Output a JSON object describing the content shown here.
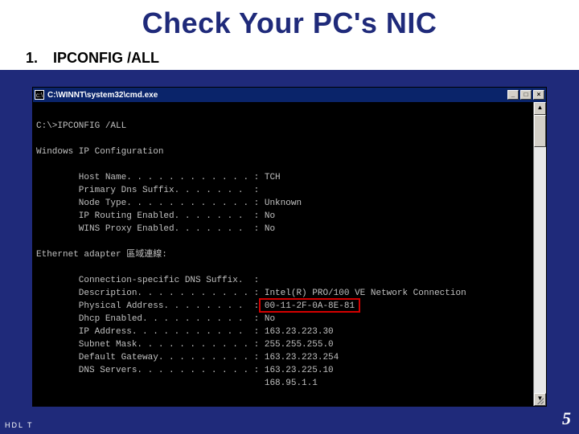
{
  "slide": {
    "title": "Check Your PC's NIC",
    "list_number": "1.",
    "list_label": "IPCONFIG /ALL",
    "footer_left": "HDL  T",
    "page_number": "5"
  },
  "cmdwin": {
    "title": "C:\\WINNT\\system32\\cmd.exe",
    "btn_min": "_",
    "btn_max": "□",
    "btn_close": "×",
    "scroll_up": "▲",
    "scroll_down": "▼"
  },
  "terminal": {
    "prompt_line": "C:\\>IPCONFIG /ALL",
    "header1": "Windows IP Configuration",
    "rows1": [
      {
        "label": "Host Name",
        "value": "TCH"
      },
      {
        "label": "Primary Dns Suffix",
        "value": ""
      },
      {
        "label": "Node Type",
        "value": "Unknown"
      },
      {
        "label": "IP Routing Enabled",
        "value": "No"
      },
      {
        "label": "WINS Proxy Enabled",
        "value": "No"
      }
    ],
    "adapter_line": "Ethernet adapter 區域連線:",
    "rows2": [
      {
        "label": "Connection-specific DNS Suffix",
        "value": ""
      },
      {
        "label": "Description",
        "value": "Intel(R) PRO/100 VE Network Connection"
      },
      {
        "label": "Physical Address",
        "value": "00-11-2F-0A-8E-81"
      },
      {
        "label": "Dhcp Enabled",
        "value": "No"
      },
      {
        "label": "IP Address",
        "value": "163.23.223.30"
      },
      {
        "label": "Subnet Mask",
        "value": "255.255.255.0"
      },
      {
        "label": "Default Gateway",
        "value": "163.23.223.254"
      },
      {
        "label": "DNS Servers",
        "value": "163.23.225.10"
      }
    ],
    "extra_dns": "168.95.1.1"
  }
}
